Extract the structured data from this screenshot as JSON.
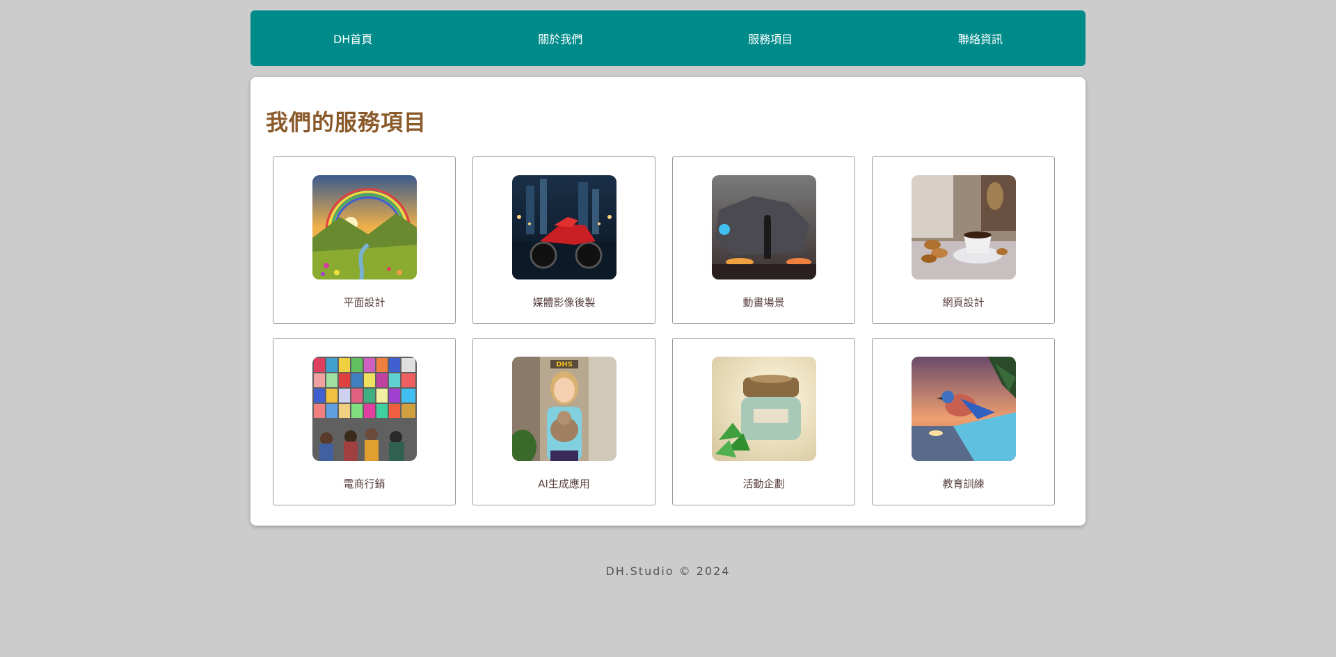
{
  "nav": {
    "items": [
      {
        "label": "DH首頁"
      },
      {
        "label": "關於我們"
      },
      {
        "label": "服務項目"
      },
      {
        "label": "聯絡資訊"
      }
    ]
  },
  "main": {
    "title": "我們的服務項目",
    "services": [
      {
        "label": "平面設計",
        "image": "rainbow-valley-image"
      },
      {
        "label": "媒體影像後製",
        "image": "red-motorcycle-image"
      },
      {
        "label": "動畫場景",
        "image": "scifi-mech-scene-image"
      },
      {
        "label": "網頁設計",
        "image": "coffee-cookies-image"
      },
      {
        "label": "電商行銷",
        "image": "poster-wall-crowd-image"
      },
      {
        "label": "AI生成應用",
        "image": "girl-holding-cat-image"
      },
      {
        "label": "活動企劃",
        "image": "cosmetic-jar-mint-image"
      },
      {
        "label": "教育訓練",
        "image": "bird-sunset-image"
      }
    ]
  },
  "footer": {
    "text": "DH.Studio © 2024"
  },
  "colors": {
    "page_background": "#cccccc",
    "navbar": "#008b8b",
    "title": "#8b5a2b",
    "panel": "#ffffff"
  }
}
